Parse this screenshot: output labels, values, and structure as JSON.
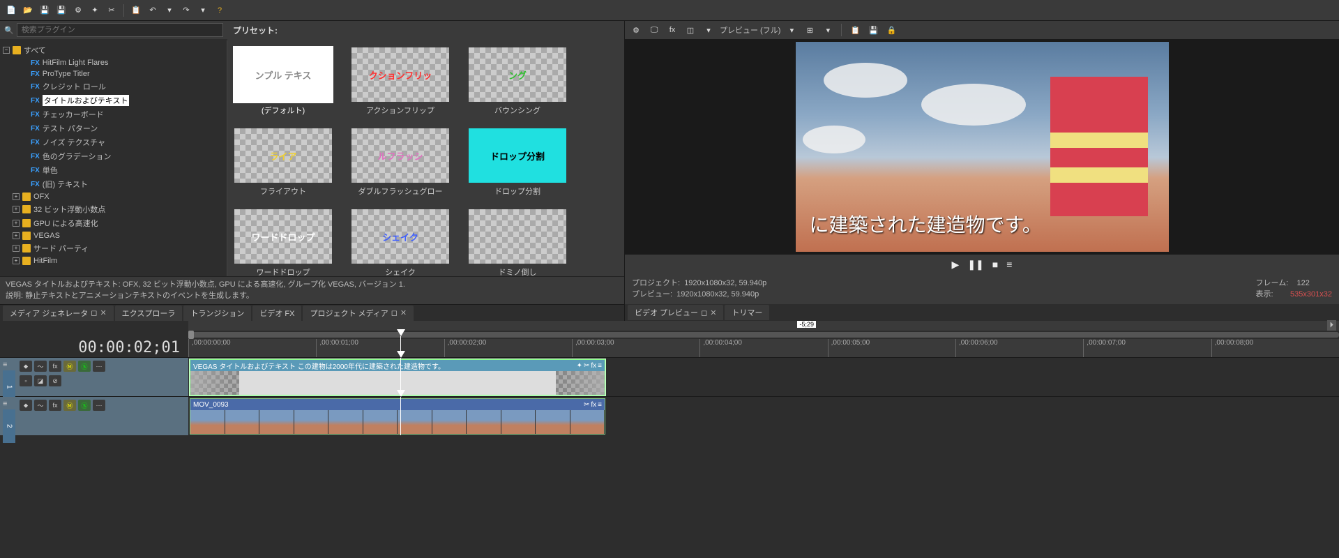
{
  "toolbar": {
    "icons": [
      "new",
      "open",
      "save",
      "save-as",
      "settings",
      "render",
      "cut",
      "copy",
      "paste",
      "undo",
      "redo",
      "help"
    ]
  },
  "search": {
    "placeholder": "検索プラグイン"
  },
  "preset_header": "プリセット:",
  "tree": {
    "root": "すべて",
    "fx_items": [
      "HitFilm Light Flares",
      "ProType Titler",
      "クレジット ロール",
      "タイトルおよびテキスト",
      "チェッカーボード",
      "テスト パターン",
      "ノイズ テクスチャ",
      "色のグラデーション",
      "単色",
      "(旧) テキスト"
    ],
    "selected_fx": "タイトルおよびテキスト",
    "folders": [
      "OFX",
      "32 ビット浮動小数点",
      "GPU による高速化",
      "VEGAS",
      "サード パーティ",
      "HitFilm"
    ]
  },
  "presets": [
    {
      "name": "(デフォルト)",
      "text": "ンプル テキス",
      "color": "#888",
      "bg": "white",
      "sel": true
    },
    {
      "name": "アクションフリップ",
      "text": "クションフリッ",
      "color": "#ff3030"
    },
    {
      "name": "バウンシング",
      "text": "ング",
      "color": "#30c030"
    },
    {
      "name": "フライアウト",
      "text": "ライア",
      "color": "#f0d030"
    },
    {
      "name": "ダブルフラッシュグロー",
      "text": "ルフラッシ",
      "color": "#e070c0"
    },
    {
      "name": "ドロップ分割",
      "text": "ドロップ分割",
      "color": "#000",
      "bg": "#20e0e0"
    },
    {
      "name": "ワードドロップ",
      "text": "ワードドロップ",
      "color": "#fff"
    },
    {
      "name": "シェイク",
      "text": "シェイク",
      "color": "#4060ff"
    },
    {
      "name": "ドミノ倒し",
      "text": "",
      "color": "#50a0f0"
    }
  ],
  "description": {
    "line1": "VEGAS タイトルおよびテキスト: OFX, 32 ビット浮動小数点, GPU による高速化, グループ化 VEGAS, バージョン 1.",
    "line2": "説明: 静止テキストとアニメーションテキストのイベントを生成します。"
  },
  "tabs_left": [
    "メディア ジェネレータ",
    "エクスプローラ",
    "トランジション",
    "ビデオ FX",
    "プロジェクト メディア"
  ],
  "preview_toolbar": {
    "label": "プレビュー (フル)"
  },
  "preview_text": "に建築された建造物です。",
  "info": {
    "project_label": "プロジェクト:",
    "project_val": "1920x1080x32, 59.940p",
    "preview_label": "プレビュー:",
    "preview_val": "1920x1080x32, 59.940p",
    "frame_label": "フレーム:",
    "frame_val": "122",
    "display_label": "表示:",
    "display_val": "535x301x32"
  },
  "tabs_right": [
    "ビデオ プレビュー",
    "トリマー"
  ],
  "timeline": {
    "marker": "-5;29",
    "current_time": "00:00:02;01",
    "ticks": [
      ",00:00:00;00",
      ",00:00:01;00",
      ",00:00:02;00",
      ",00:00:03;00",
      ",00:00:04;00",
      ",00:00:05;00",
      ",00:00:06;00",
      ",00:00:07;00",
      ",00:00:08;00"
    ],
    "track1": {
      "num": "1",
      "clip_title": "VEGAS タイトルおよびテキスト この建物は2000年代に建築された建造物です。"
    },
    "track2": {
      "num": "2",
      "clip_title": "MOV_0093"
    }
  }
}
